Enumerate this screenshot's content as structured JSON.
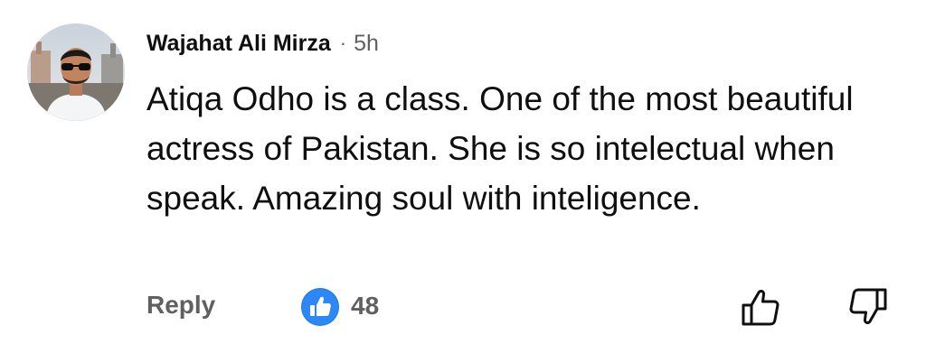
{
  "comment": {
    "author": "Wajahat Ali Mirza",
    "separator": "·",
    "time": "5h",
    "text": "Atiqa Odho is a class. One of the most beautiful actress of Pakistan. She is so intelectual when speak. Amazing soul with inteligence.",
    "avatar_icon": "profile-photo",
    "actions": {
      "reply_label": "Reply",
      "like_count": "48",
      "reaction_icon": "thumbs-up-badge-icon",
      "like_icon": "thumbs-up-outline-icon",
      "dislike_icon": "thumbs-down-outline-icon"
    }
  },
  "colors": {
    "text_primary": "#0f0f0f",
    "text_secondary": "#606060",
    "reaction_blue": "#1877f2",
    "background": "#ffffff"
  }
}
